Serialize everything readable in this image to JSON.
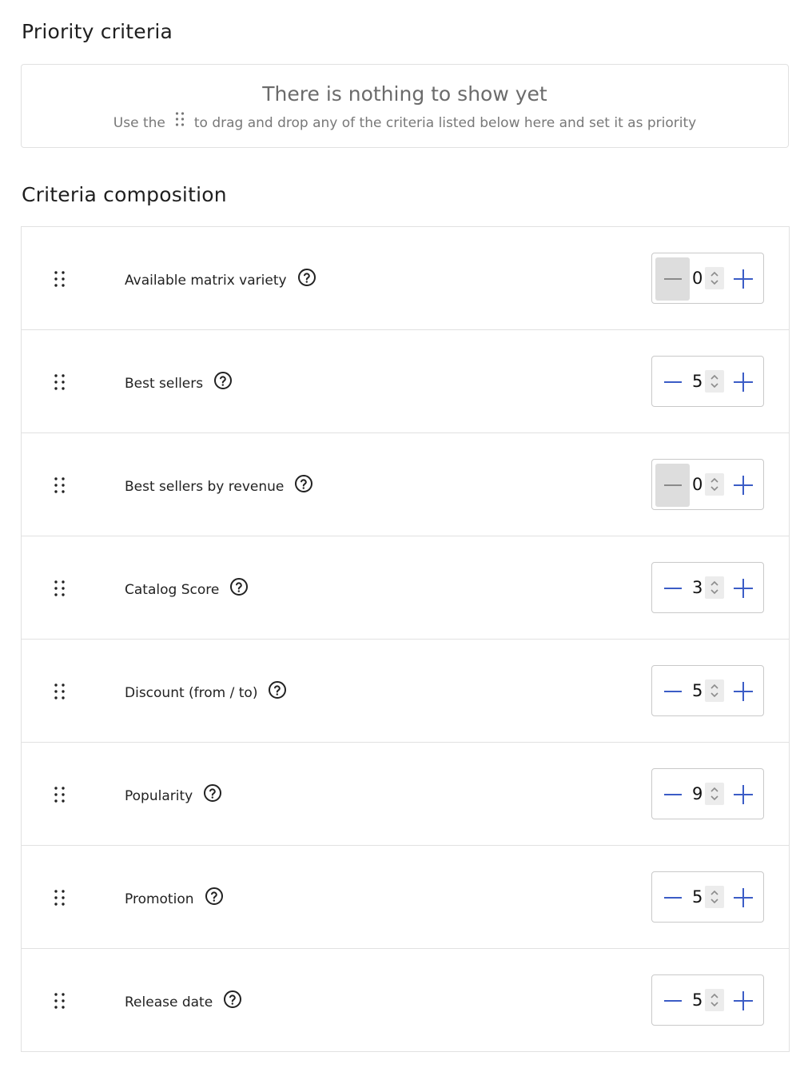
{
  "priority": {
    "title": "Priority criteria",
    "empty_heading": "There is nothing to show yet",
    "hint_prefix": "Use the",
    "hint_suffix": "to drag and drop any of the criteria listed below here and set it as priority"
  },
  "composition": {
    "title": "Criteria composition",
    "rows": [
      {
        "label": "Available matrix variety",
        "value": "0",
        "minus_disabled": true
      },
      {
        "label": "Best sellers",
        "value": "5",
        "minus_disabled": false
      },
      {
        "label": "Best sellers by revenue",
        "value": "0",
        "minus_disabled": true
      },
      {
        "label": "Catalog Score",
        "value": "3",
        "minus_disabled": false
      },
      {
        "label": "Discount (from / to)",
        "value": "5",
        "minus_disabled": false
      },
      {
        "label": "Popularity",
        "value": "9",
        "minus_disabled": false
      },
      {
        "label": "Promotion",
        "value": "5",
        "minus_disabled": false
      },
      {
        "label": "Release date",
        "value": "5",
        "minus_disabled": false
      }
    ]
  },
  "colors": {
    "accent": "#3b5cc6",
    "disabled_minus": "#8a8a8a",
    "border": "#e1e1e1"
  },
  "icons": {
    "drag": "drag-handle-icon",
    "help": "question-circle-icon",
    "minus": "minus-icon",
    "plus": "plus-icon",
    "spin": "spin-arrows-icon"
  }
}
